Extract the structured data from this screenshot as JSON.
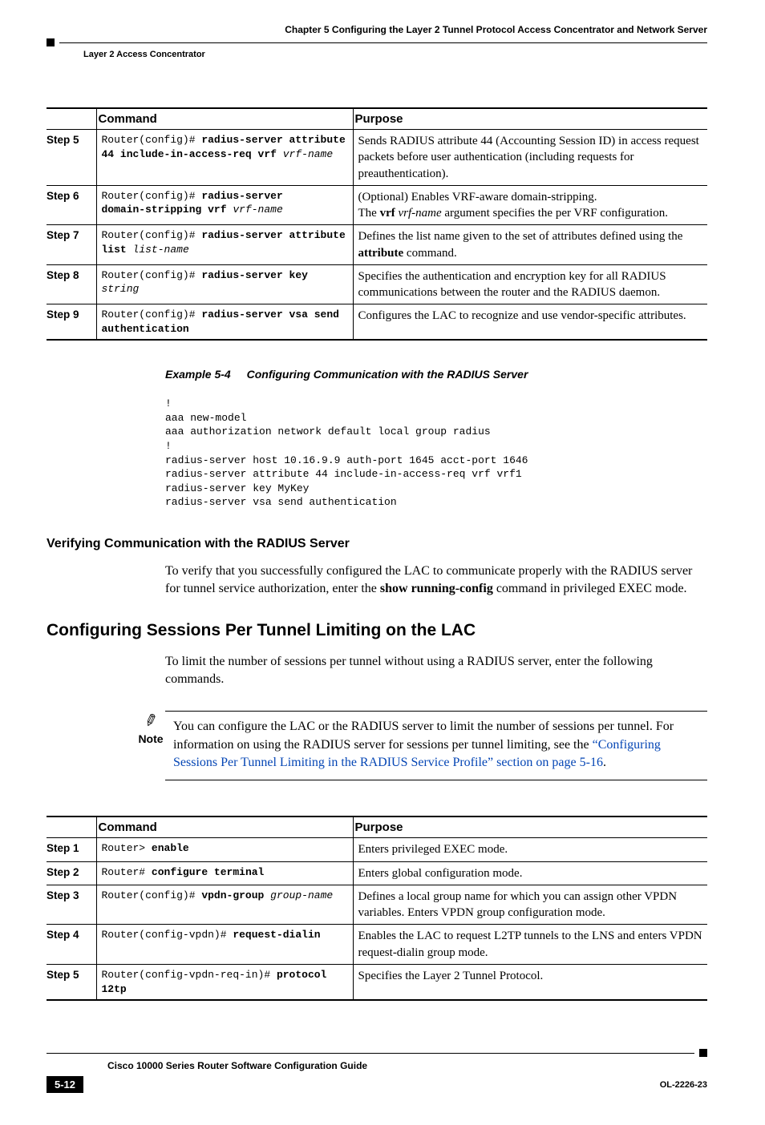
{
  "header": {
    "chapter": "Chapter 5    Configuring the Layer 2 Tunnel Protocol Access Concentrator and Network Server",
    "section": "Layer 2 Access Concentrator"
  },
  "table1": {
    "head_command": "Command",
    "head_purpose": "Purpose",
    "rows": [
      {
        "step": "Step 5",
        "cmd_html": "Router(config)# <b>radius-server attribute<br>44 include-in-access-req vrf</b> <i>vrf-name</i>",
        "purpose_html": "Sends RADIUS attribute 44 (Accounting Session ID) in access request packets before user authentication (including requests for preauthentication)."
      },
      {
        "step": "Step 6",
        "cmd_html": "Router(config)# <b>radius-server<br>domain-stripping vrf</b> <i>vrf-name</i>",
        "purpose_html": "(Optional) Enables VRF-aware domain-stripping.<br>The <b>vrf</b> <i>vrf-name</i> argument specifies the per VRF configuration."
      },
      {
        "step": "Step 7",
        "cmd_html": "Router(config)# <b>radius-server attribute<br>list</b> <i>list-name</i>",
        "purpose_html": "Defines the list name given to the set of attributes defined using the <b>attribute</b> command."
      },
      {
        "step": "Step 8",
        "cmd_html": "Router(config)# <b>radius-server key</b> <i>string</i>",
        "purpose_html": "Specifies the authentication and encryption key for all RADIUS communications between the router and the RADIUS daemon."
      },
      {
        "step": "Step 9",
        "cmd_html": "Router(config)# <b>radius-server vsa send<br>authentication</b>",
        "purpose_html": "Configures the LAC to recognize and use vendor-specific attributes."
      }
    ]
  },
  "example": {
    "caption_num": "Example 5-4",
    "caption_title": "Configuring Communication with the RADIUS Server",
    "code": "!\naaa new-model\naaa authorization network default local group radius\n!\nradius-server host 10.16.9.9 auth-port 1645 acct-port 1646\nradius-server attribute 44 include-in-access-req vrf vrf1\nradius-server key MyKey\nradius-server vsa send authentication"
  },
  "verify": {
    "heading": "Verifying Communication with the RADIUS Server",
    "body_html": "To verify that you successfully configured the LAC to communicate properly with the RADIUS server for tunnel service authorization, enter the <b>show running-config</b> command in privileged EXEC mode."
  },
  "sessions": {
    "heading": "Configuring Sessions Per Tunnel Limiting on the LAC",
    "body": "To limit the number of sessions per tunnel without using a RADIUS server, enter the following commands."
  },
  "note": {
    "label": "Note",
    "body_prefix": "You can configure the LAC or the RADIUS server to limit the number of sessions per tunnel. For information on using the RADIUS server for sessions per tunnel limiting, see the ",
    "link_text": "“Configuring Sessions Per Tunnel Limiting in the RADIUS Service Profile” section on page 5-16",
    "body_suffix": "."
  },
  "table2": {
    "head_command": "Command",
    "head_purpose": "Purpose",
    "rows": [
      {
        "step": "Step 1",
        "cmd_html": "Router> <b>enable</b>",
        "purpose_html": "Enters privileged EXEC mode."
      },
      {
        "step": "Step 2",
        "cmd_html": "Router# <b>configure terminal</b>",
        "purpose_html": "Enters global configuration mode."
      },
      {
        "step": "Step 3",
        "cmd_html": "Router(config)# <b>vpdn-group</b> <i>group-name</i>",
        "purpose_html": "Defines a local group name for which you can assign other VPDN variables. Enters VPDN group configuration mode."
      },
      {
        "step": "Step 4",
        "cmd_html": "Router(config-vpdn)# <b>request-dialin</b>",
        "purpose_html": "Enables the LAC to request L2TP tunnels to the LNS and enters VPDN request-dialin group mode."
      },
      {
        "step": "Step 5",
        "cmd_html": "Router(config-vpdn-req-in)# <b>protocol 12tp</b>",
        "purpose_html": "Specifies the Layer 2 Tunnel Protocol."
      }
    ]
  },
  "footer": {
    "guide": "Cisco 10000 Series Router Software Configuration Guide",
    "page": "5-12",
    "docnum": "OL-2226-23"
  }
}
